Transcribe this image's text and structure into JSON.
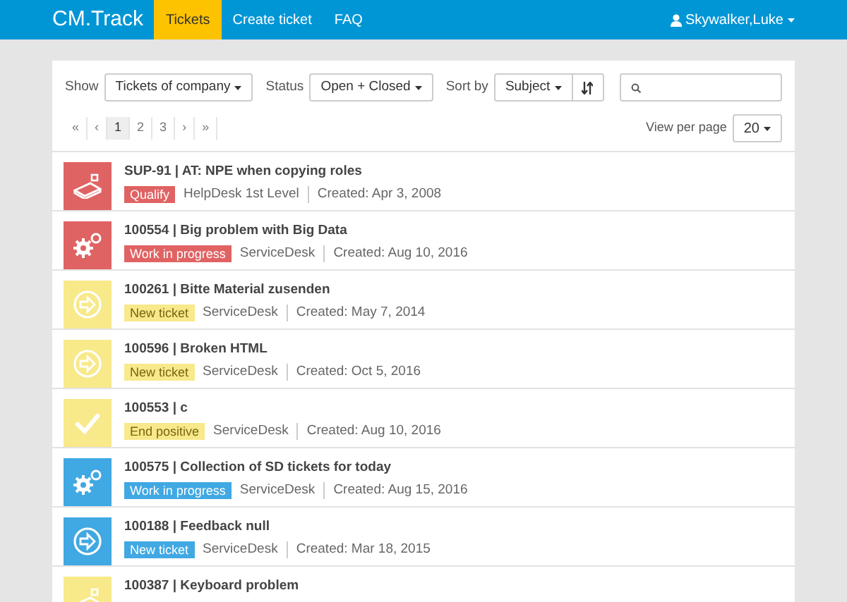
{
  "navbar": {
    "brand": "CM.Track",
    "items": [
      {
        "label": "Tickets",
        "selected": true
      },
      {
        "label": "Create ticket",
        "selected": false
      },
      {
        "label": "FAQ",
        "selected": false
      }
    ],
    "user": "Skywalker,Luke"
  },
  "filters": {
    "show_label": "Show",
    "show_value": "Tickets of company",
    "status_label": "Status",
    "status_value": "Open + Closed",
    "sort_label": "Sort by",
    "sort_value": "Subject"
  },
  "pagination": {
    "pages": [
      {
        "label": "«",
        "selected": false
      },
      {
        "label": "‹",
        "selected": false
      },
      {
        "label": "1",
        "selected": true
      },
      {
        "label": "2",
        "selected": false
      },
      {
        "label": "3",
        "selected": false
      },
      {
        "label": "›",
        "selected": false
      },
      {
        "label": "»",
        "selected": false
      }
    ],
    "per_page_label": "View per page",
    "per_page_value": "20"
  },
  "tickets": [
    {
      "title": "SUP-91 | AT: NPE when copying roles",
      "kind": "hand",
      "color": "#e06363",
      "status": "Qualify",
      "group": "HelpDesk 1st Level",
      "created": "Created: Apr 3, 2008"
    },
    {
      "title": "100554 | Big problem with Big Data",
      "kind": "gears",
      "color": "#e06363",
      "status": "Work in progress",
      "group": "ServiceDesk",
      "created": "Created: Aug 10, 2016"
    },
    {
      "title": "100261 | Bitte Material zusenden",
      "kind": "arrow",
      "color": "#f8e98a",
      "status": "New ticket",
      "group": "ServiceDesk",
      "created": "Created: May 7, 2014"
    },
    {
      "title": "100596 | Broken HTML",
      "kind": "arrow",
      "color": "#f8e98a",
      "status": "New ticket",
      "group": "ServiceDesk",
      "created": "Created: Oct 5, 2016"
    },
    {
      "title": "100553 | c",
      "kind": "check",
      "color": "#f8e98a",
      "status": "End positive",
      "group": "ServiceDesk",
      "created": "Created: Aug 10, 2016"
    },
    {
      "title": "100575 | Collection of SD tickets for today",
      "kind": "gears",
      "color": "#40a8e2",
      "status": "Work in progress",
      "group": "ServiceDesk",
      "created": "Created: Aug 15, 2016"
    },
    {
      "title": "100188 | Feedback null",
      "kind": "arrow",
      "color": "#40a8e2",
      "status": "New ticket",
      "group": "ServiceDesk",
      "created": "Created: Mar 18, 2015"
    },
    {
      "title": "100387 | Keyboard problem",
      "kind": "hand",
      "color": "#f8e98a"
    }
  ]
}
